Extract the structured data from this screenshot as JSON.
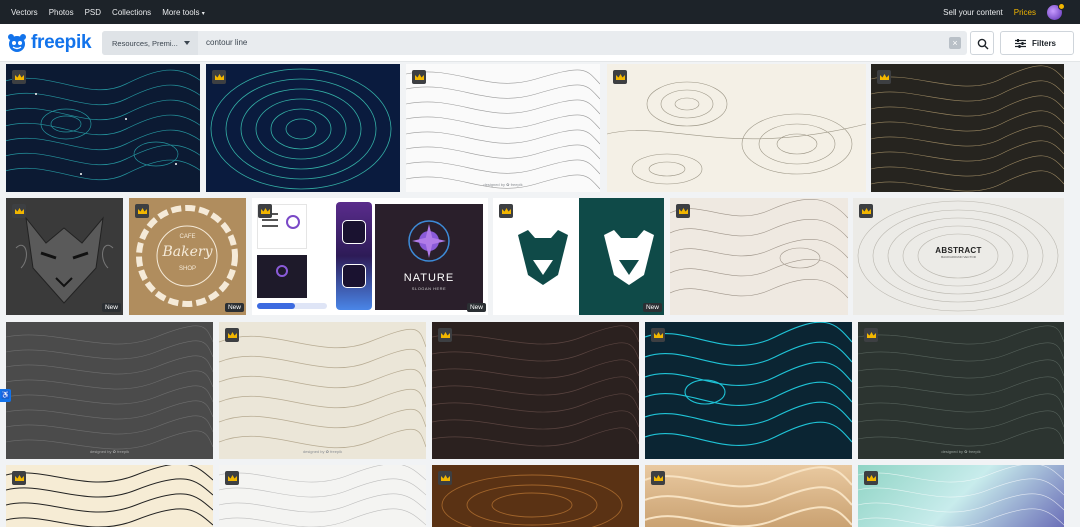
{
  "topbar": {
    "nav": [
      "Vectors",
      "Photos",
      "PSD",
      "Collections",
      "More tools"
    ],
    "sell": "Sell your content",
    "prices": "Prices"
  },
  "header": {
    "logo_text": "freepik",
    "search": {
      "resource_select": "Resources, Premi...",
      "query": "contour line"
    },
    "filters_label": "Filters"
  },
  "grid": {
    "new_badge": "New",
    "watermark": "designed by ✿ freepik",
    "nature_title": "NATURE",
    "nature_sub": "SLOGAN HERE",
    "abstract_title": "ABSTRACT",
    "abstract_sub": "BACKGROUND VECTOR",
    "bakery_top": "CAFE",
    "bakery_mid": "Bakery",
    "bakery_bot": "SHOP"
  },
  "colors": {
    "brand": "#1273eb",
    "topbar_bg": "#1d2329",
    "premium_gold": "#f2b600"
  }
}
